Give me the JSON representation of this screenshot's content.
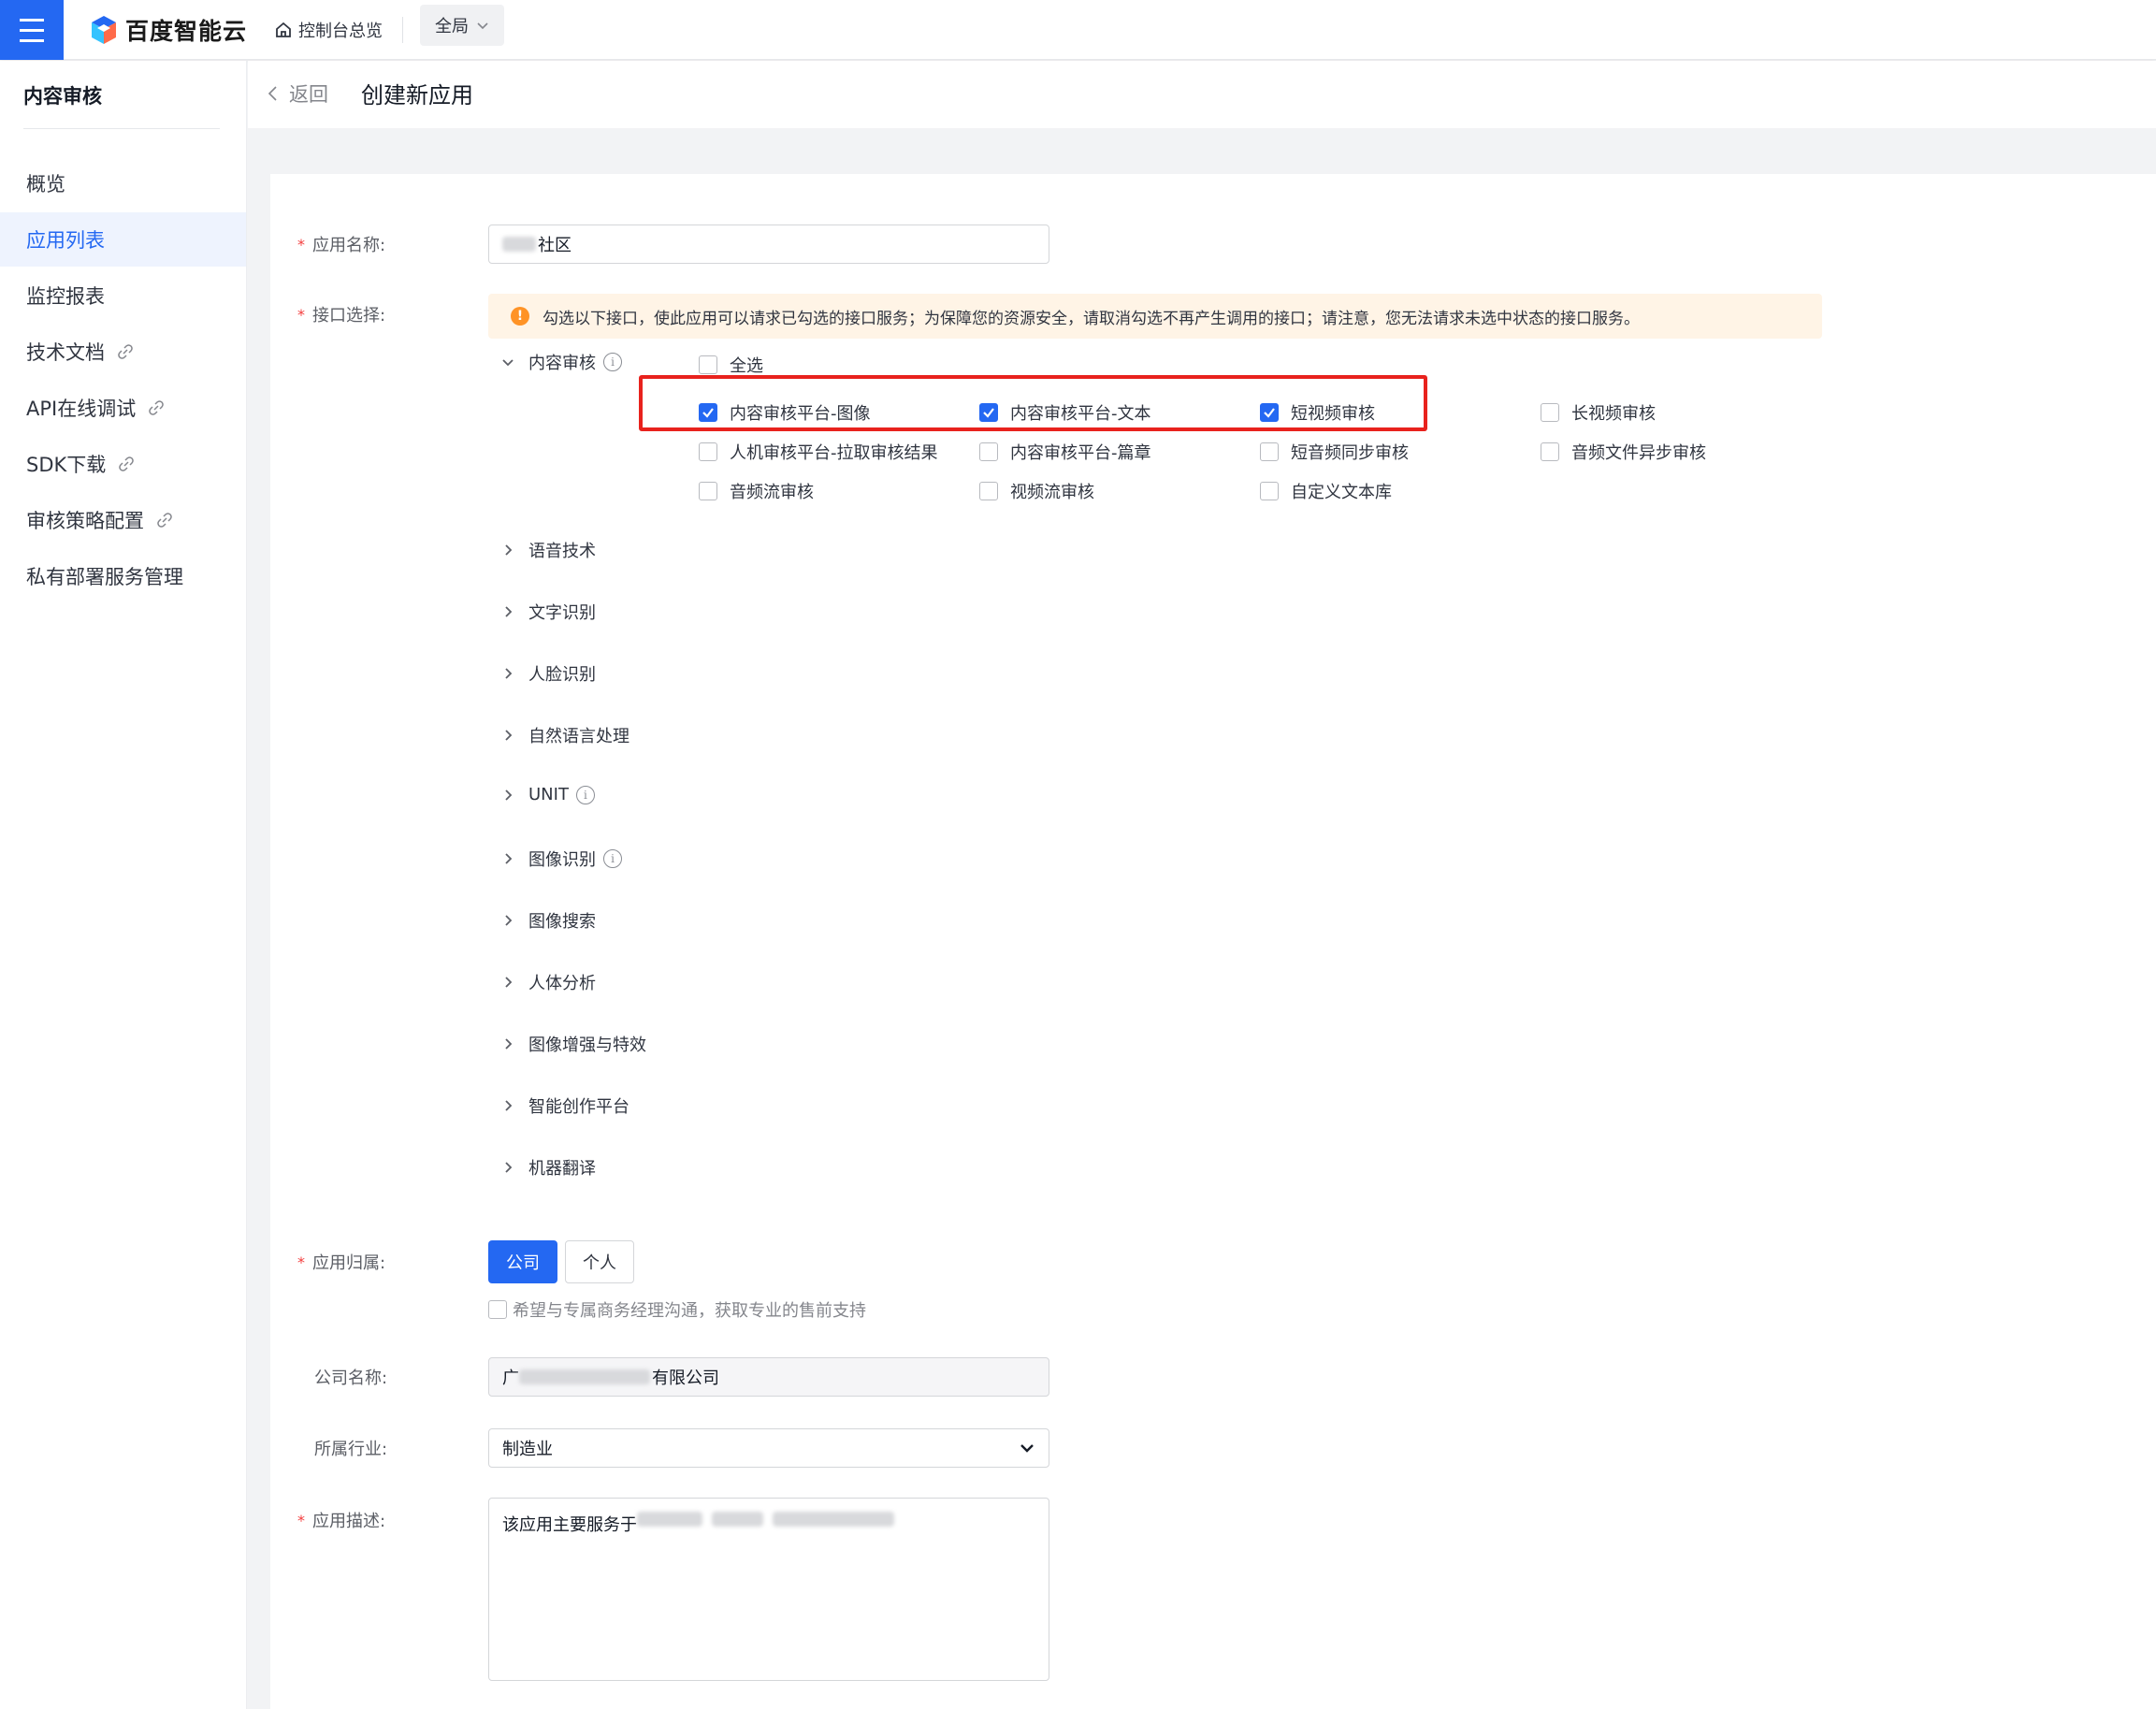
{
  "topbar": {
    "brand": "百度智能云",
    "home_label": "控制台总览",
    "scope_label": "全局"
  },
  "sidebar": {
    "title": "内容审核",
    "items": [
      {
        "label": "概览",
        "active": false,
        "external": false
      },
      {
        "label": "应用列表",
        "active": true,
        "external": false
      },
      {
        "label": "监控报表",
        "active": false,
        "external": false
      },
      {
        "label": "技术文档",
        "active": false,
        "external": true
      },
      {
        "label": "API在线调试",
        "active": false,
        "external": true
      },
      {
        "label": "SDK下载",
        "active": false,
        "external": true
      },
      {
        "label": "审核策略配置",
        "active": false,
        "external": true
      },
      {
        "label": "私有部署服务管理",
        "active": false,
        "external": false
      }
    ]
  },
  "header": {
    "back_label": "返回",
    "title": "创建新应用"
  },
  "form": {
    "app_name": {
      "label": "应用名称:",
      "value_suffix": "社区"
    },
    "api_select": {
      "label": "接口选择:",
      "notice": "勾选以下接口，使此应用可以请求已勾选的接口服务；为保障您的资源安全，请取消勾选不再产生调用的接口；请注意，您无法请求未选中状态的接口服务。",
      "expanded_group": "内容审核",
      "select_all": "全选",
      "options": [
        {
          "label": "内容审核平台-图像",
          "checked": true
        },
        {
          "label": "内容审核平台-文本",
          "checked": true
        },
        {
          "label": "短视频审核",
          "checked": true
        },
        {
          "label": "长视频审核",
          "checked": false
        },
        {
          "label": "人机审核平台-拉取审核结果",
          "checked": false
        },
        {
          "label": "内容审核平台-篇章",
          "checked": false
        },
        {
          "label": "短音频同步审核",
          "checked": false
        },
        {
          "label": "音频文件异步审核",
          "checked": false
        },
        {
          "label": "音频流审核",
          "checked": false
        },
        {
          "label": "视频流审核",
          "checked": false
        },
        {
          "label": "自定义文本库",
          "checked": false
        }
      ],
      "collapsed_groups": [
        {
          "label": "语音技术",
          "info": false
        },
        {
          "label": "文字识别",
          "info": false
        },
        {
          "label": "人脸识别",
          "info": false
        },
        {
          "label": "自然语言处理",
          "info": false
        },
        {
          "label": "UNIT",
          "info": true
        },
        {
          "label": "图像识别",
          "info": true
        },
        {
          "label": "图像搜索",
          "info": false
        },
        {
          "label": "人体分析",
          "info": false
        },
        {
          "label": "图像增强与特效",
          "info": false
        },
        {
          "label": "智能创作平台",
          "info": false
        },
        {
          "label": "机器翻译",
          "info": false
        }
      ]
    },
    "owner": {
      "label": "应用归属:",
      "options": [
        "公司",
        "个人"
      ],
      "selected": "公司",
      "contact_checkbox": "希望与专属商务经理沟通，获取专业的售前支持"
    },
    "company": {
      "label": "公司名称:",
      "value_prefix": "广",
      "value_suffix": "有限公司"
    },
    "industry": {
      "label": "所属行业:",
      "value": "制造业"
    },
    "description": {
      "label": "应用描述:",
      "value_prefix": "该应用主要服务于"
    }
  },
  "colors": {
    "accent": "#2468f2",
    "highlight_frame": "#e8221d",
    "required": "#f33e3e"
  }
}
